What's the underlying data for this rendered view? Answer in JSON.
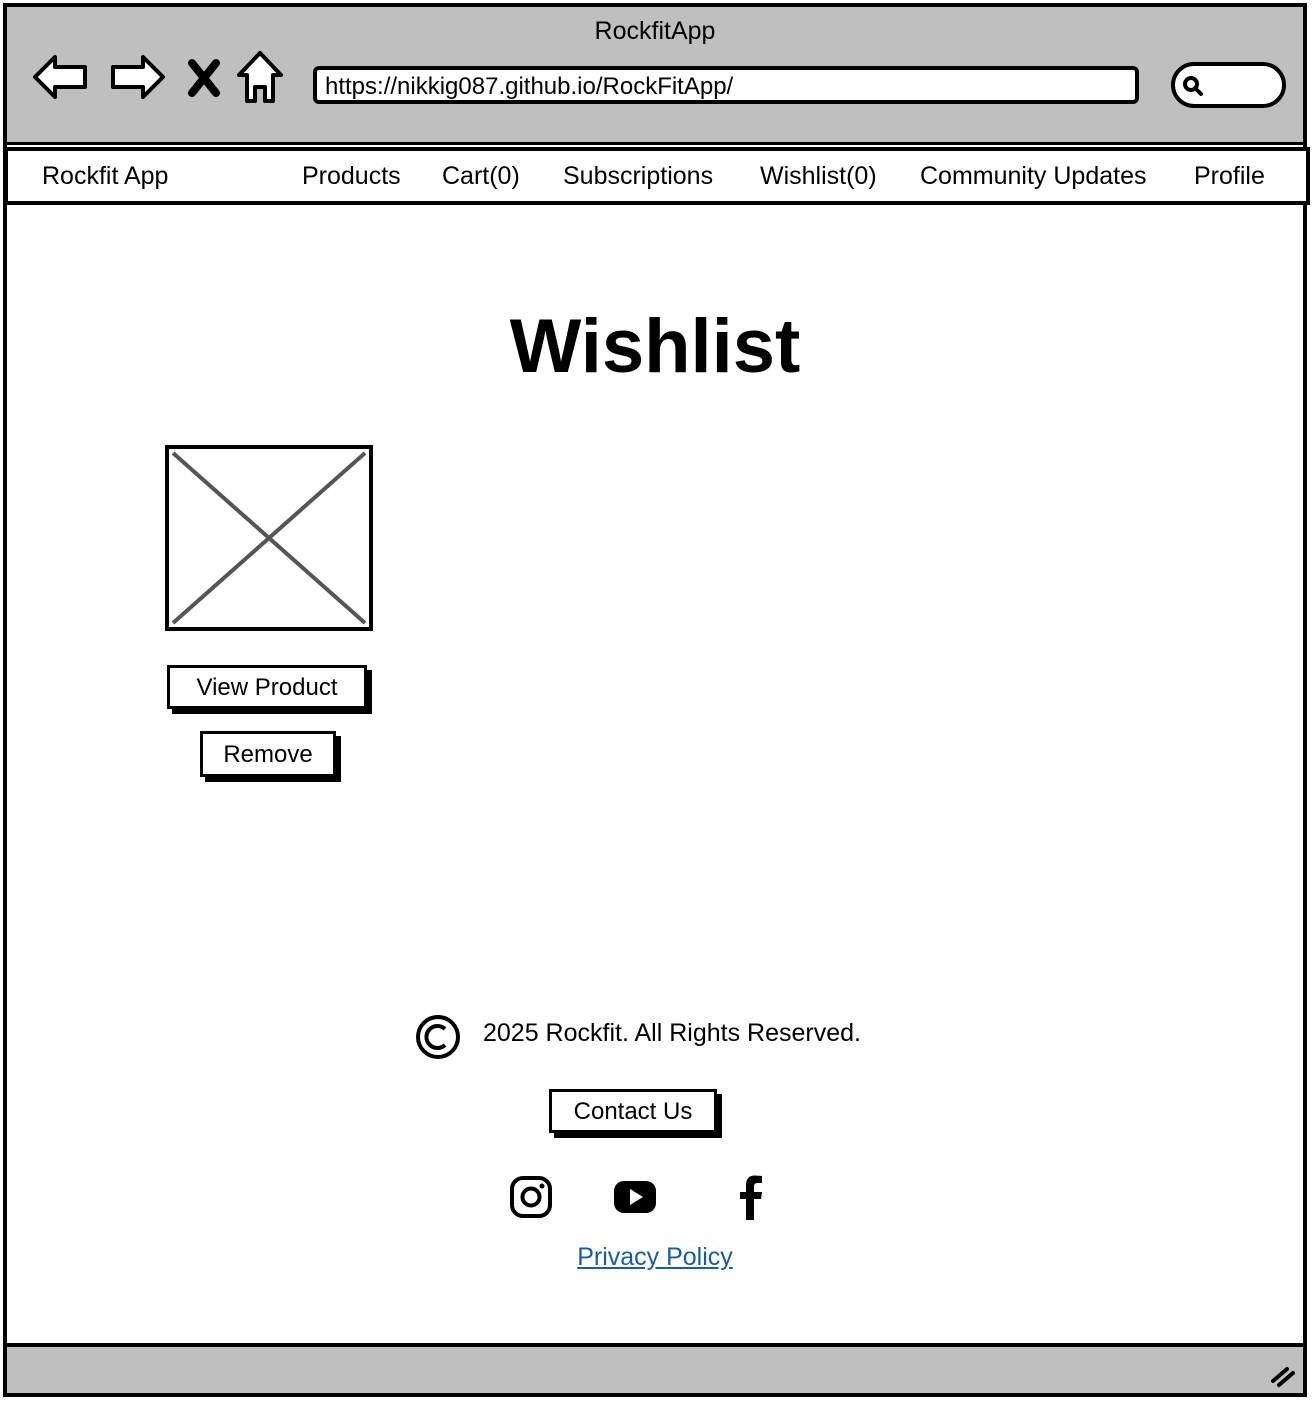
{
  "window": {
    "title": "RockfitApp"
  },
  "browser": {
    "url": "https://nikkig087.github.io/RockFitApp/"
  },
  "nav": {
    "brand": "Rockfit App",
    "items": [
      {
        "label": "Products"
      },
      {
        "label": "Cart(0)"
      },
      {
        "label": "Subscriptions"
      },
      {
        "label": "Wishlist(0)"
      },
      {
        "label": "Community Updates"
      },
      {
        "label": "Profile"
      }
    ]
  },
  "page": {
    "heading": "Wishlist",
    "item": {
      "image_icon": "image-placeholder-icon",
      "view_button": "View Product",
      "remove_button": "Remove"
    }
  },
  "footer": {
    "copyright": "2025 Rockfit. All Rights Reserved.",
    "contact_button": "Contact Us",
    "social_icons": [
      "instagram-icon",
      "youtube-icon",
      "facebook-icon"
    ],
    "privacy_link": "Privacy Policy"
  },
  "colors": {
    "chrome": "#bfbfbf",
    "link": "#1a5c9c"
  }
}
